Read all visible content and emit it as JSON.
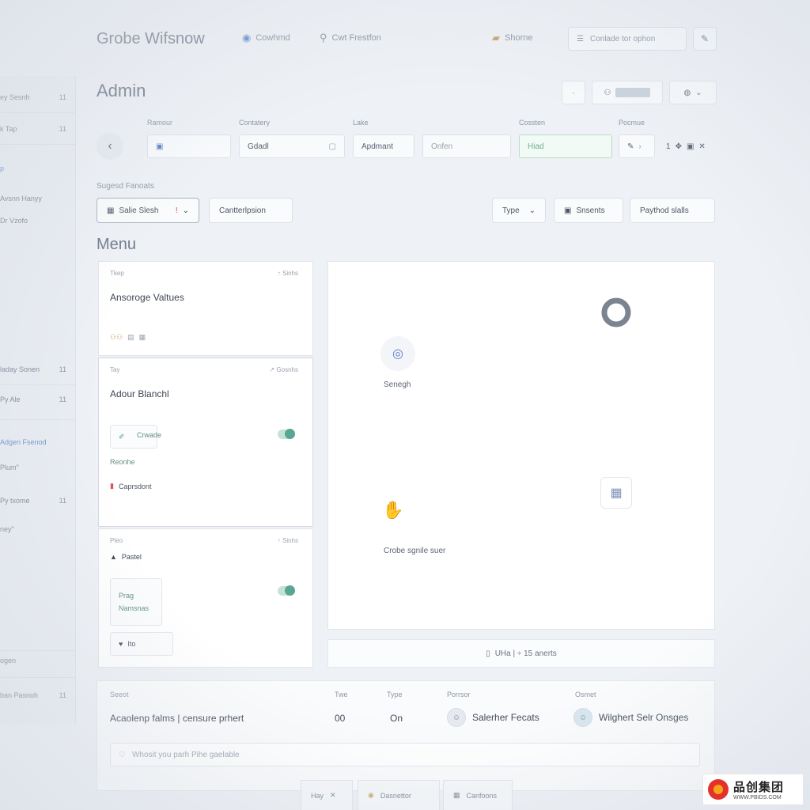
{
  "app": {
    "title": "Grobe Wifsnow",
    "links": [
      {
        "icon": "pin-icon",
        "label": "Cowhmd"
      },
      {
        "icon": "key-icon",
        "label": "Cwt Frestfon"
      },
      {
        "icon": "folder-icon",
        "label": "Shorne"
      }
    ],
    "search_placeholder": "Conlade tor ophon"
  },
  "sidebar": {
    "items": [
      {
        "label": "ey Sesnh",
        "count": "11"
      },
      {
        "label": "k Tap",
        "count": "11"
      },
      {
        "label": "p",
        "count": ""
      },
      {
        "label": "Avsnn Hanyy",
        "count": ""
      },
      {
        "label": "Dr Vzofo",
        "count": ""
      },
      {
        "label": "laday Sonen",
        "count": "11"
      },
      {
        "label": "Py Ale",
        "count": "11"
      },
      {
        "label": "Adgen Fsenod",
        "count": ""
      },
      {
        "label": "Plum\"",
        "count": ""
      },
      {
        "label": "Py txome",
        "count": "11"
      },
      {
        "label": "ney\"",
        "count": ""
      },
      {
        "label": "ogen",
        "count": ""
      },
      {
        "label": "ban Pasnoh",
        "count": "11"
      }
    ]
  },
  "header": {
    "title": "Admin"
  },
  "filters": {
    "labels": [
      "Ramour",
      "Contatery",
      "Lake",
      "Cossten",
      "Pocmue"
    ],
    "fields": [
      "",
      "Gdadl",
      "Apdmant",
      "Onfen",
      "Hiad",
      "",
      "1"
    ]
  },
  "suggested": {
    "label": "Sugesd Fanoats",
    "pills": [
      "Salie Slesh",
      "Cantterlpsion",
      "Type",
      "Snsents",
      "Paythod slalls"
    ]
  },
  "menu": {
    "title": "Menu",
    "cards": [
      {
        "tag": "Tkep",
        "link": "↑ Sinhs",
        "heading": "Ansoroge Valtues"
      },
      {
        "tag": "Tay",
        "link": "↗ Gosnhs",
        "heading": "Adour Blanchl",
        "rows": [
          "Crwade",
          "Reonhe",
          "Caprsdont"
        ]
      },
      {
        "tag": "Pleo",
        "link": "↑ Sinhs",
        "heading": "Pastel",
        "rows": [
          "Prag",
          "Namsnas",
          "Ito"
        ]
      }
    ]
  },
  "panel": {
    "search_label": "Senegh",
    "hint_label": "Crobe sgnile suer"
  },
  "footer_strip": {
    "label": "UHa | ÷ 15 anerts"
  },
  "table": {
    "headers": [
      "Seeot",
      "Twe",
      "Type",
      "Porrsor",
      "Osmet"
    ],
    "row": {
      "name": "Acaolenp falms | censure prhert",
      "col2": "00",
      "col3": "On",
      "person1": "Salerher Fecats",
      "person2": "Wilghert Selr Onsges"
    },
    "note_placeholder": "Whosit you parh Pihe gaelable"
  },
  "dock": {
    "items": [
      "Hay",
      "Dasnettor",
      "Canfoons"
    ]
  },
  "watermark": {
    "brand": "品创集团",
    "url": "WWW.PBIDS.COM"
  }
}
